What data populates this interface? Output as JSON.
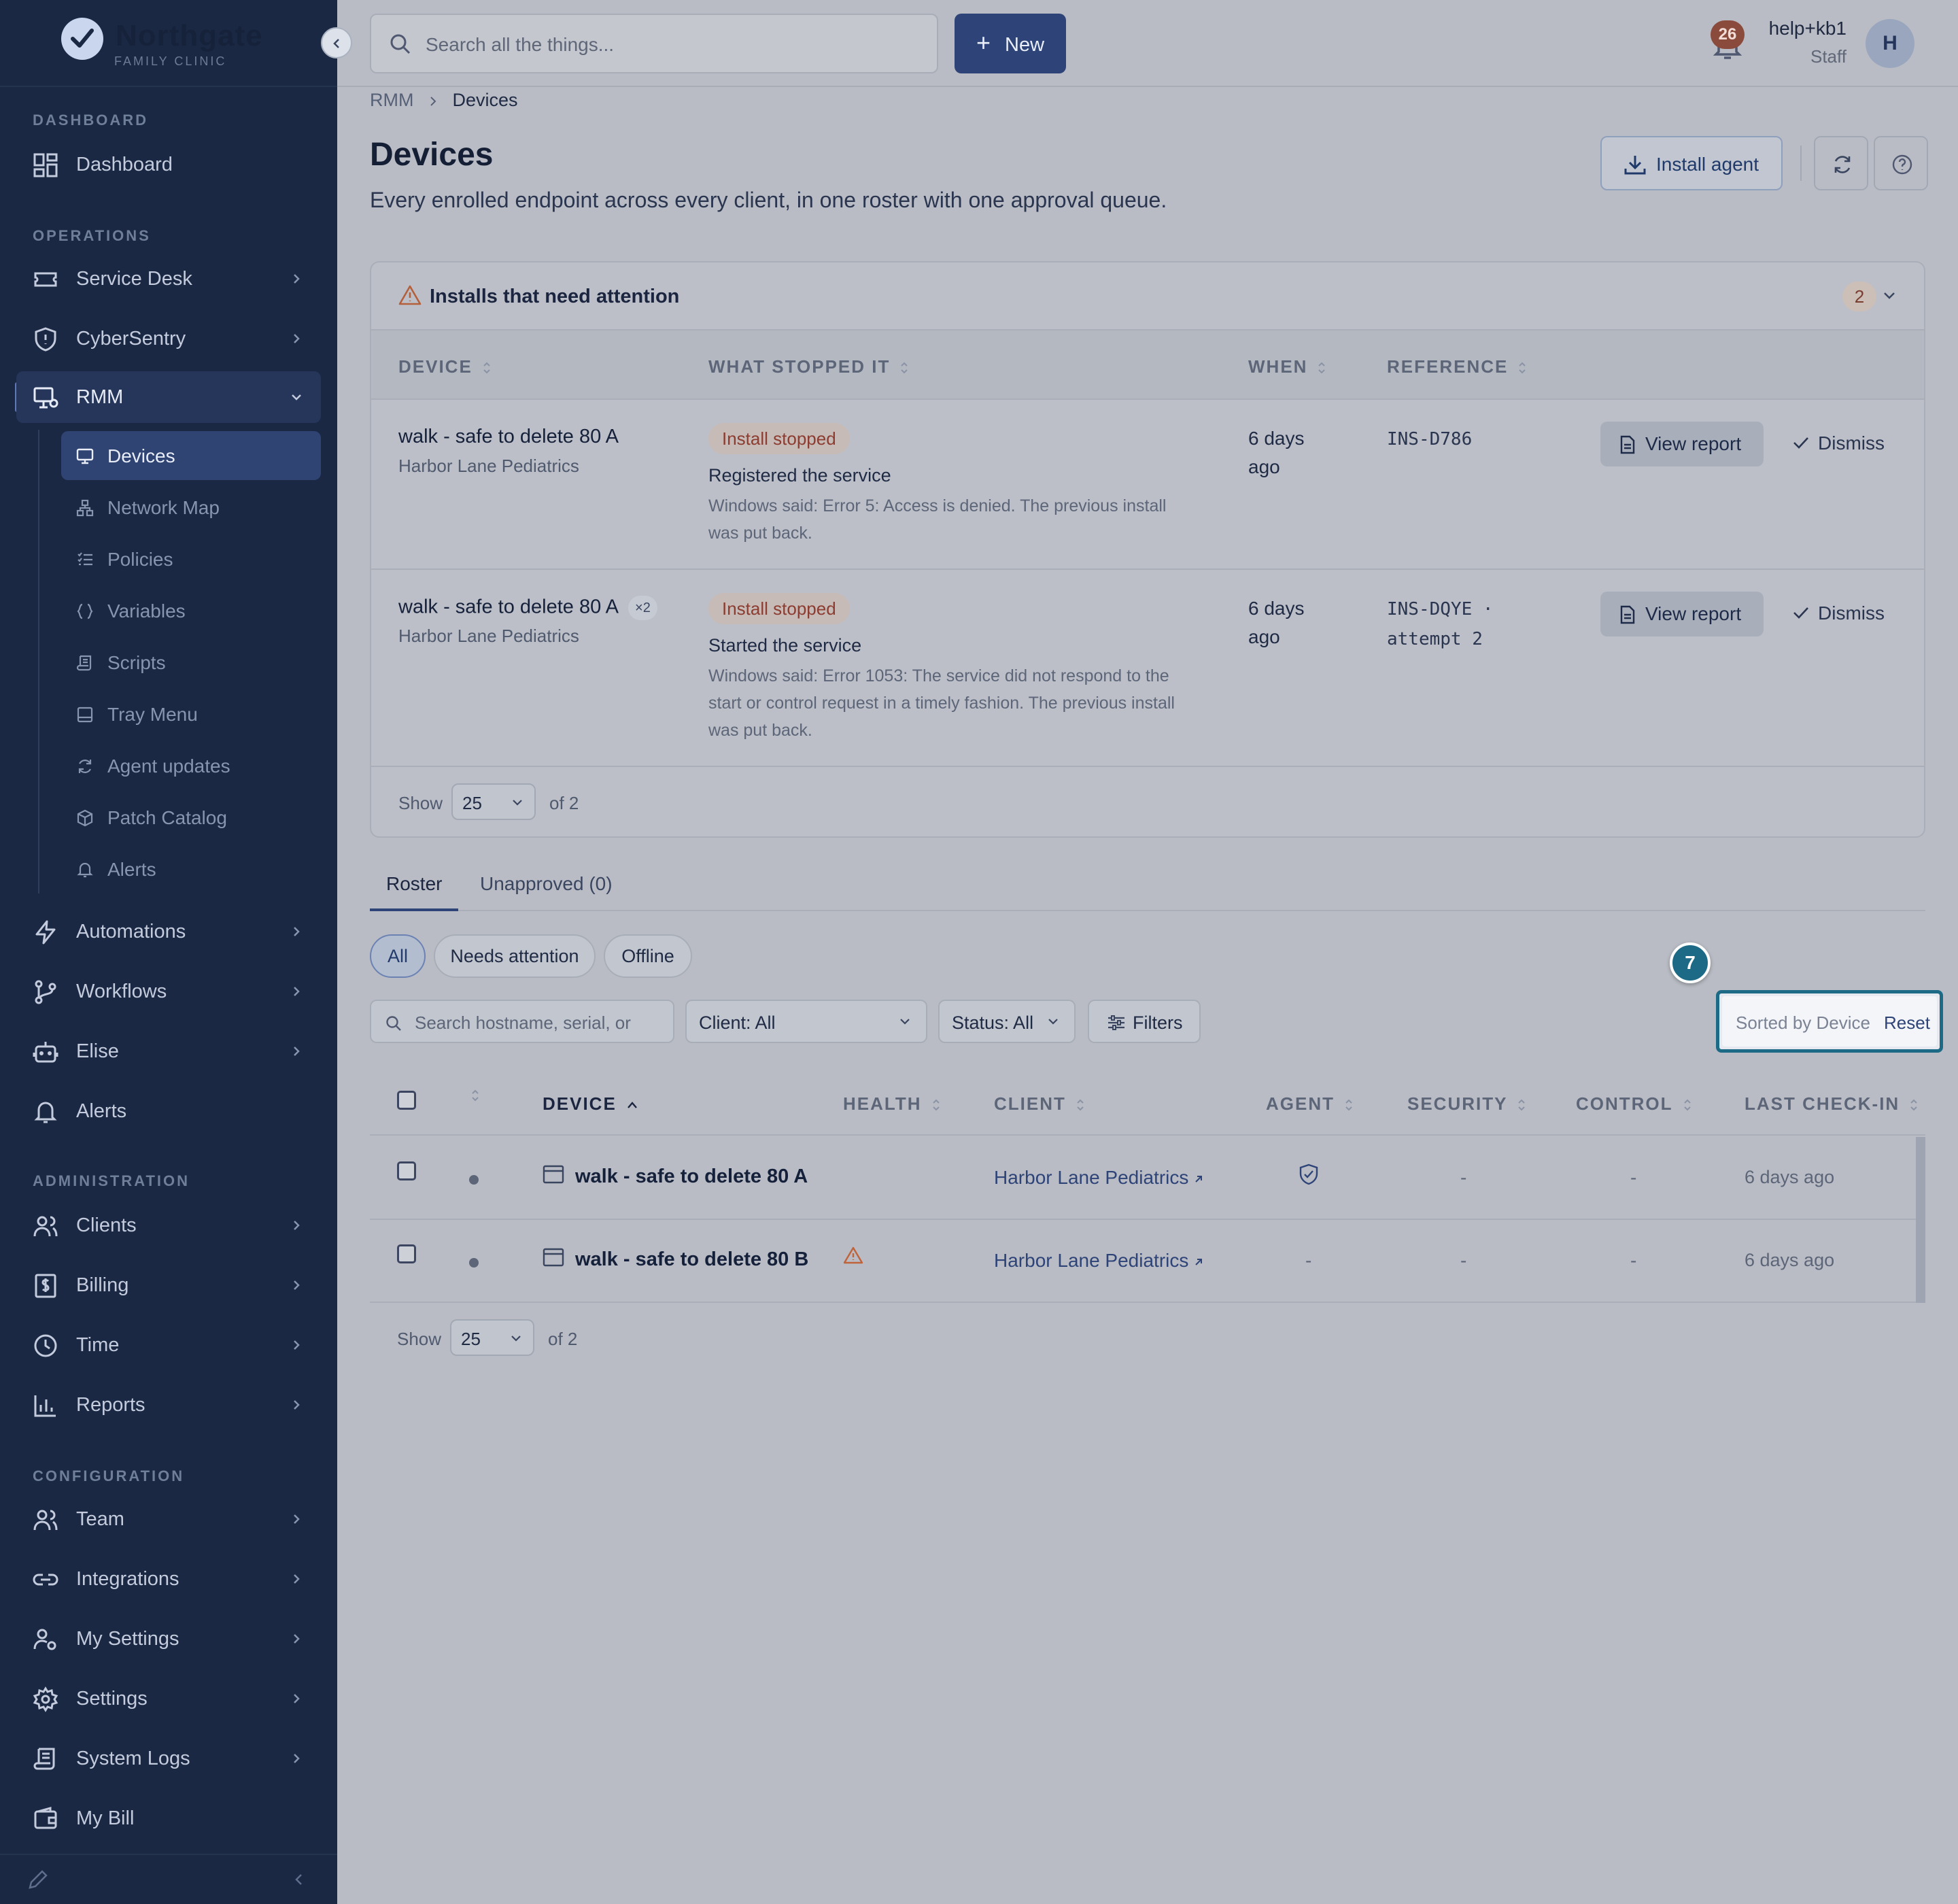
{
  "brand": {
    "name": "Northgate",
    "subtitle": "FAMILY CLINIC"
  },
  "topbar": {
    "search_placeholder": "Search all the things...",
    "new_label": "New",
    "notification_count": "26",
    "user_name": "help+kb1",
    "user_role": "Staff",
    "avatar_initial": "H"
  },
  "sidebar": {
    "sections": {
      "dashboard": "DASHBOARD",
      "operations": "OPERATIONS",
      "administration": "ADMINISTRATION",
      "configuration": "CONFIGURATION"
    },
    "items": {
      "dashboard": "Dashboard",
      "service_desk": "Service Desk",
      "cybersentry": "CyberSentry",
      "rmm": "RMM",
      "automations": "Automations",
      "workflows": "Workflows",
      "elise": "Elise",
      "alerts": "Alerts",
      "clients": "Clients",
      "billing": "Billing",
      "time": "Time",
      "reports": "Reports",
      "team": "Team",
      "integrations": "Integrations",
      "my_settings": "My Settings",
      "settings": "Settings",
      "system_logs": "System Logs",
      "my_bill": "My Bill"
    },
    "rmm_sub": {
      "devices": "Devices",
      "network_map": "Network Map",
      "policies": "Policies",
      "variables": "Variables",
      "scripts": "Scripts",
      "tray_menu": "Tray Menu",
      "agent_updates": "Agent updates",
      "patch_catalog": "Patch Catalog",
      "alerts": "Alerts"
    }
  },
  "breadcrumb": {
    "root": "RMM",
    "current": "Devices"
  },
  "page": {
    "title": "Devices",
    "subtitle": "Every enrolled endpoint across every client, in one roster with one approval queue.",
    "install_agent": "Install agent"
  },
  "attention": {
    "title": "Installs that need attention",
    "count": "2",
    "headers": {
      "device": "DEVICE",
      "stopped": "WHAT STOPPED IT",
      "when": "WHEN",
      "reference": "REFERENCE"
    },
    "rows": [
      {
        "device": "walk - safe to delete 80 A",
        "badge": "",
        "client": "Harbor Lane Pediatrics",
        "status": "Install stopped",
        "step": "Registered the service",
        "detail": "Windows said: Error 5: Access is denied. The previous install was put back.",
        "when_1": "6 days",
        "when_2": "ago",
        "ref_1": "INS-D786",
        "ref_2": "",
        "view": "View report",
        "dismiss": "Dismiss"
      },
      {
        "device": "walk - safe to delete 80 A",
        "badge": "×2",
        "client": "Harbor Lane Pediatrics",
        "status": "Install stopped",
        "step": "Started the service",
        "detail": "Windows said: Error 1053: The service did not respond to the start or control request in a timely fashion. The previous install was put back.",
        "when_1": "6 days",
        "when_2": "ago",
        "ref_1": "INS-DQYE ·",
        "ref_2": "attempt 2",
        "view": "View report",
        "dismiss": "Dismiss"
      }
    ],
    "pager": {
      "show": "Show",
      "size": "25",
      "of": "of 2"
    }
  },
  "tabs": {
    "roster": "Roster",
    "unapproved": "Unapproved (0)"
  },
  "chips": {
    "all": "All",
    "needs_attention": "Needs attention",
    "offline": "Offline"
  },
  "filters": {
    "search_placeholder": "Search hostname, serial, or",
    "client": "Client: All",
    "status": "Status: All",
    "filters": "Filters",
    "sorted_by": "Sorted by Device",
    "reset": "Reset",
    "step_marker": "7"
  },
  "roster": {
    "headers": {
      "device": "DEVICE",
      "health": "HEALTH",
      "client": "CLIENT",
      "agent": "AGENT",
      "security": "SECURITY",
      "control": "CONTROL",
      "last_checkin": "LAST CHECK-IN"
    },
    "rows": [
      {
        "device": "walk - safe to delete 80 A",
        "client": "Harbor Lane Pediatrics",
        "agent": "",
        "security": "-",
        "control": "-",
        "checkin": "6 days ago"
      },
      {
        "device": "walk - safe to delete 80 B",
        "client": "Harbor Lane Pediatrics",
        "agent": "-",
        "security": "-",
        "control": "-",
        "checkin": "6 days ago"
      }
    ],
    "pager": {
      "show": "Show",
      "size": "25",
      "of": "of 2"
    }
  },
  "colors": {
    "sidebar_bg": "#1a2844",
    "accent": "#2e4478",
    "highlight": "#1d6a86",
    "warning": "#c0623a"
  }
}
